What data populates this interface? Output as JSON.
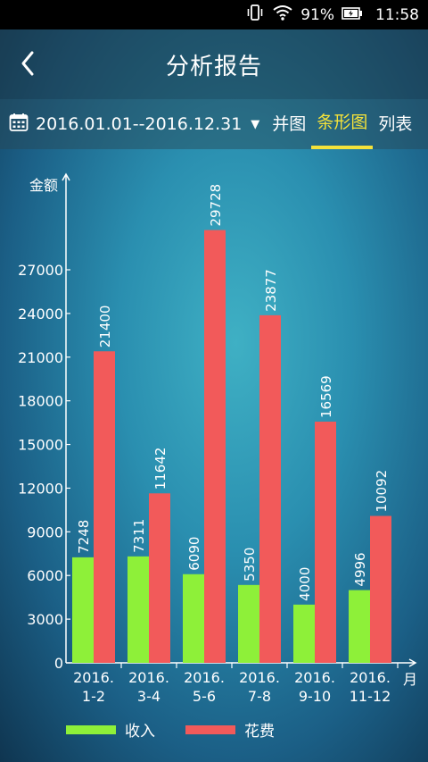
{
  "status_bar": {
    "battery": "91%",
    "time": "11:58",
    "icons": [
      "vibrate-icon",
      "wifi-icon",
      "battery-icon"
    ]
  },
  "header": {
    "title": "分析报告",
    "back_icon": "back-icon"
  },
  "toolbar": {
    "date_range": "2016.01.01--2016.12.31",
    "calendar_icon": "calendar-icon",
    "dropdown_icon": "dropdown-triangle-icon",
    "tabs": [
      {
        "label": "并图",
        "active": false
      },
      {
        "label": "条形图",
        "active": true
      },
      {
        "label": "列表",
        "active": false
      }
    ]
  },
  "colors": {
    "income": "#8ef039",
    "expense": "#f25a5a",
    "active_tab": "#f4e23a"
  },
  "chart_data": {
    "type": "bar",
    "ylabel": "金额",
    "xlabel": "月",
    "ylim": [
      0,
      30000
    ],
    "yticks": [
      0,
      3000,
      6000,
      9000,
      12000,
      15000,
      18000,
      21000,
      24000,
      27000
    ],
    "categories": [
      [
        "2016.",
        "1-2"
      ],
      [
        "2016.",
        "3-4"
      ],
      [
        "2016.",
        "5-6"
      ],
      [
        "2016.",
        "7-8"
      ],
      [
        "2016.",
        "9-10"
      ],
      [
        "2016.",
        "11-12"
      ]
    ],
    "series": [
      {
        "name": "收入",
        "color": "#8ef039",
        "values": [
          7248,
          7311,
          6090,
          5350,
          4000,
          4996
        ]
      },
      {
        "name": "花费",
        "color": "#f25a5a",
        "values": [
          21400,
          11642,
          29728,
          23877,
          16569,
          10092
        ]
      }
    ],
    "legend": "bottom-left"
  }
}
